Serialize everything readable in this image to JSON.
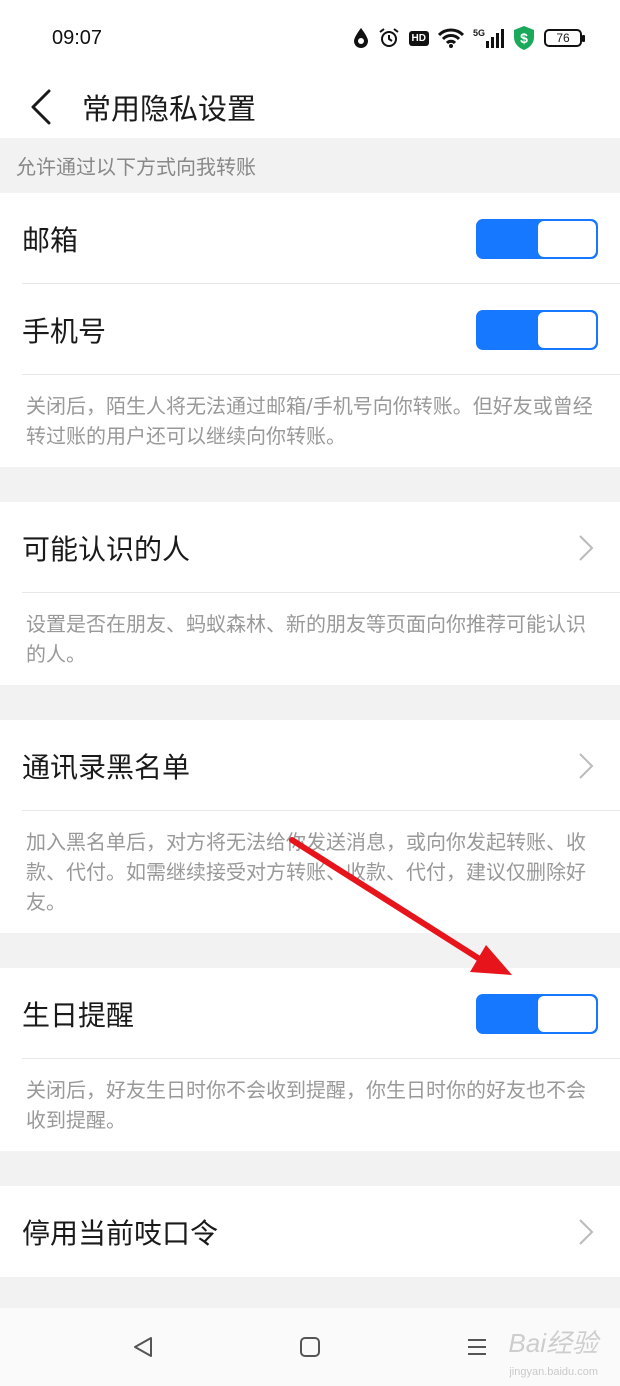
{
  "status_bar": {
    "time": "09:07",
    "network_label": "5G",
    "hd_label": "HD",
    "battery_level": "76"
  },
  "header": {
    "title": "常用隐私设置"
  },
  "section_transfer": {
    "heading": "允许通过以下方式向我转账",
    "items": [
      {
        "label": "邮箱",
        "enabled": true
      },
      {
        "label": "手机号",
        "enabled": true
      }
    ],
    "description": "关闭后，陌生人将无法通过邮箱/手机号向你转账。但好友或曾经转过账的用户还可以继续向你转账。"
  },
  "section_people": {
    "label": "可能认识的人",
    "description": "设置是否在朋友、蚂蚁森林、新的朋友等页面向你推荐可能认识的人。"
  },
  "section_blacklist": {
    "label": "通讯录黑名单",
    "description": "加入黑名单后，对方将无法给你发送消息，或向你发起转账、收款、代付。如需继续接受对方转账、收款、代付，建议仅删除好友。"
  },
  "section_birthday": {
    "label": "生日提醒",
    "enabled": true,
    "description": "关闭后，好友生日时你不会收到提醒，你生日时你的好友也不会收到提醒。"
  },
  "section_code": {
    "label": "停用当前吱口令"
  },
  "watermark": {
    "brand": "Bai经验",
    "url": "jingyan.baidu.com"
  },
  "colors": {
    "accent": "#1677ff",
    "annotation_arrow": "#e8141b"
  }
}
